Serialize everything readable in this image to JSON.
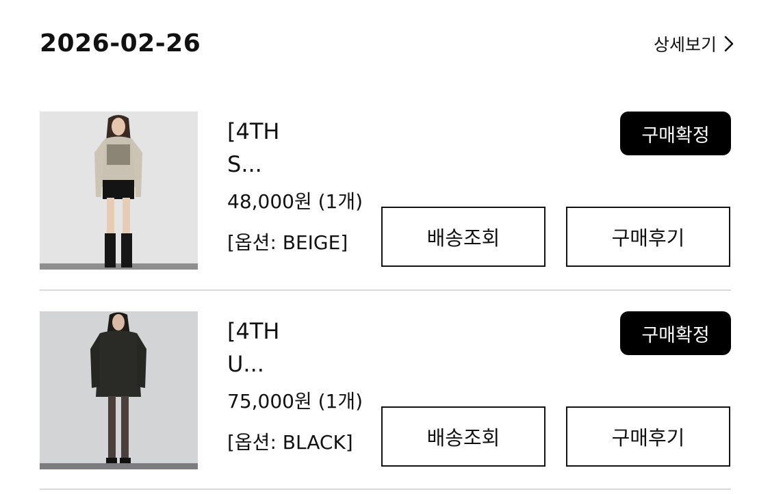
{
  "order": {
    "date": "2026-02-26",
    "detail_link": "상세보기"
  },
  "items": [
    {
      "name": "[4TH",
      "name_ellipsis": "S...",
      "price": "48,000원 (1개)",
      "option": "[옵션: BEIGE]",
      "status": "구매확정",
      "track_label": "배송조회",
      "review_label": "구매후기",
      "image": "product-photo-model-beige-top"
    },
    {
      "name": "[4TH",
      "name_ellipsis": "U...",
      "price": "75,000원 (1개)",
      "option": "[옵션: BLACK]",
      "status": "구매확정",
      "track_label": "배송조회",
      "review_label": "구매후기",
      "image": "product-photo-model-black-sweater"
    }
  ],
  "icons": {
    "detail_chevron": "chevron-right-icon"
  },
  "colors": {
    "badge_bg": "#000000",
    "badge_text": "#ffffff",
    "divider": "#d9d9d9"
  }
}
